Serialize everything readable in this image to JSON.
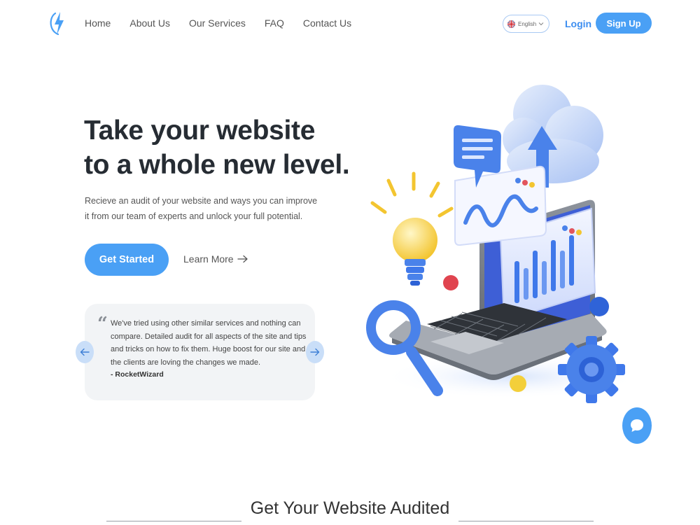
{
  "nav": {
    "links": [
      "Home",
      "About Us",
      "Our Services",
      "FAQ",
      "Contact Us"
    ],
    "language": "English",
    "login": "Login",
    "signup": "Sign Up"
  },
  "hero": {
    "title_line1": "Take your website",
    "title_line2": "to a whole new level.",
    "subtitle": "Recieve an audit of your website and ways you can improve it from our team of experts and unlock your full potential.",
    "cta_primary": "Get Started",
    "cta_secondary": "Learn More"
  },
  "testimonial": {
    "quote": "We've tried using other similar services and nothing can compare. Detailed audit for all aspects of the site and tips and tricks on how to fix them. Huge boost for our site and the clients are loving the changes we made.",
    "author": "- RocketWizard"
  },
  "section": {
    "title": "Get Your Website Audited"
  },
  "icons": {
    "logo": "lightning-bolt-icon",
    "flag": "uk-flag-icon",
    "chevron": "chevron-down-icon",
    "arrow_right": "arrow-right-icon",
    "prev": "arrow-left-icon",
    "next": "arrow-right-icon",
    "quote": "quote-icon",
    "chat": "chat-bubble-icon"
  },
  "colors": {
    "accent": "#4aa0f5",
    "link": "#3d8ef0",
    "heading": "#262c33",
    "card_bg": "#f2f4f6",
    "arrow_bg": "#c9def8"
  }
}
